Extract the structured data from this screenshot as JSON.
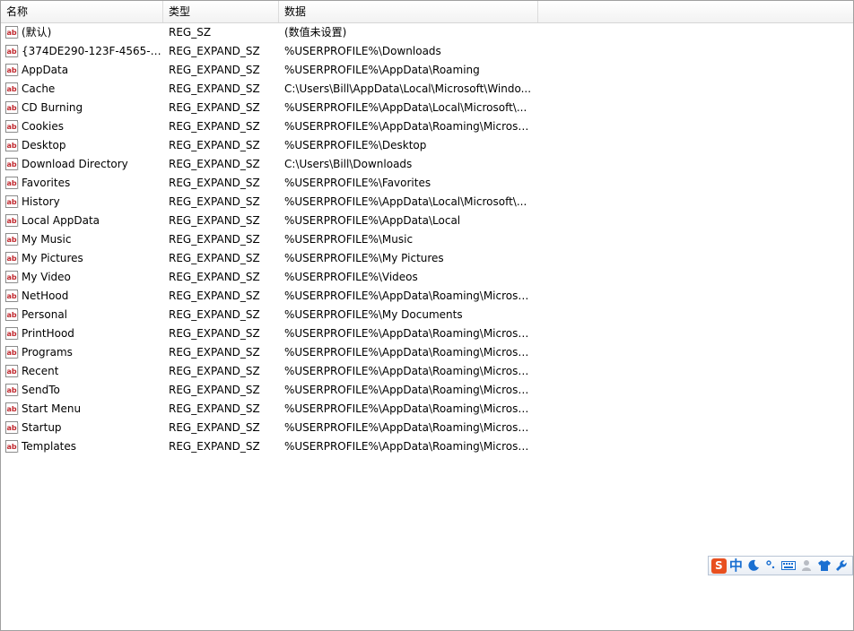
{
  "columns": {
    "name": "名称",
    "type": "类型",
    "data": "数据"
  },
  "rows": [
    {
      "name": "(默认)",
      "type": "REG_SZ",
      "data": "(数值未设置)"
    },
    {
      "name": "{374DE290-123F-4565-91...",
      "type": "REG_EXPAND_SZ",
      "data": "%USERPROFILE%\\Downloads"
    },
    {
      "name": "AppData",
      "type": "REG_EXPAND_SZ",
      "data": "%USERPROFILE%\\AppData\\Roaming"
    },
    {
      "name": "Cache",
      "type": "REG_EXPAND_SZ",
      "data": "C:\\Users\\Bill\\AppData\\Local\\Microsoft\\Windo..."
    },
    {
      "name": "CD Burning",
      "type": "REG_EXPAND_SZ",
      "data": "%USERPROFILE%\\AppData\\Local\\Microsoft\\..."
    },
    {
      "name": "Cookies",
      "type": "REG_EXPAND_SZ",
      "data": "%USERPROFILE%\\AppData\\Roaming\\Microso..."
    },
    {
      "name": "Desktop",
      "type": "REG_EXPAND_SZ",
      "data": "%USERPROFILE%\\Desktop"
    },
    {
      "name": "Download Directory",
      "type": "REG_EXPAND_SZ",
      "data": "C:\\Users\\Bill\\Downloads"
    },
    {
      "name": "Favorites",
      "type": "REG_EXPAND_SZ",
      "data": "%USERPROFILE%\\Favorites"
    },
    {
      "name": "History",
      "type": "REG_EXPAND_SZ",
      "data": "%USERPROFILE%\\AppData\\Local\\Microsoft\\..."
    },
    {
      "name": "Local AppData",
      "type": "REG_EXPAND_SZ",
      "data": "%USERPROFILE%\\AppData\\Local"
    },
    {
      "name": "My Music",
      "type": "REG_EXPAND_SZ",
      "data": "%USERPROFILE%\\Music"
    },
    {
      "name": "My Pictures",
      "type": "REG_EXPAND_SZ",
      "data": "%USERPROFILE%\\My Pictures"
    },
    {
      "name": "My Video",
      "type": "REG_EXPAND_SZ",
      "data": "%USERPROFILE%\\Videos"
    },
    {
      "name": "NetHood",
      "type": "REG_EXPAND_SZ",
      "data": "%USERPROFILE%\\AppData\\Roaming\\Microso..."
    },
    {
      "name": "Personal",
      "type": "REG_EXPAND_SZ",
      "data": "%USERPROFILE%\\My Documents"
    },
    {
      "name": "PrintHood",
      "type": "REG_EXPAND_SZ",
      "data": "%USERPROFILE%\\AppData\\Roaming\\Microso..."
    },
    {
      "name": "Programs",
      "type": "REG_EXPAND_SZ",
      "data": "%USERPROFILE%\\AppData\\Roaming\\Microso..."
    },
    {
      "name": "Recent",
      "type": "REG_EXPAND_SZ",
      "data": "%USERPROFILE%\\AppData\\Roaming\\Microso..."
    },
    {
      "name": "SendTo",
      "type": "REG_EXPAND_SZ",
      "data": "%USERPROFILE%\\AppData\\Roaming\\Microso..."
    },
    {
      "name": "Start Menu",
      "type": "REG_EXPAND_SZ",
      "data": "%USERPROFILE%\\AppData\\Roaming\\Microso..."
    },
    {
      "name": "Startup",
      "type": "REG_EXPAND_SZ",
      "data": "%USERPROFILE%\\AppData\\Roaming\\Microso..."
    },
    {
      "name": "Templates",
      "type": "REG_EXPAND_SZ",
      "data": "%USERPROFILE%\\AppData\\Roaming\\Microso..."
    }
  ],
  "value_icon": "registry-string-value-icon",
  "ime_toolbar": {
    "logo": "S",
    "language": "中",
    "icons": [
      "moon-icon",
      "punctuation-icon",
      "keyboard-icon",
      "user-icon",
      "shirt-icon",
      "wrench-icon"
    ]
  },
  "colors": {
    "icon_red": "#c0272d",
    "ime_logo": "#e8501f",
    "ime_blue": "#1a6fd1"
  }
}
